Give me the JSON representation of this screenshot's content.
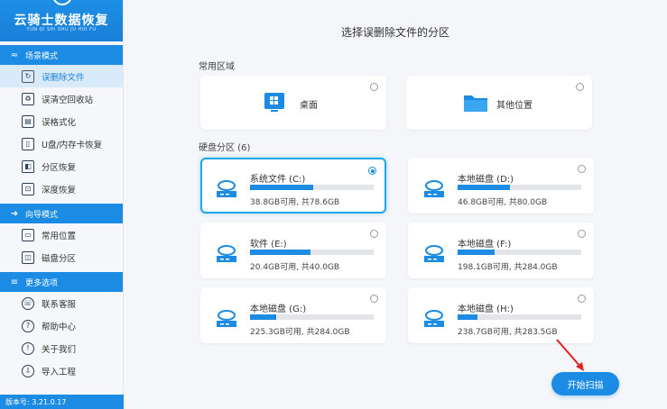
{
  "app": {
    "brand": "云骑士数据恢复",
    "brand_sub": "YUN QI SHI SHU JU HUI FU",
    "version": "版本号: 3.21.0.17"
  },
  "sidebar": {
    "sections": [
      {
        "title": "场景模式",
        "icon": "scene-icon",
        "items": [
          {
            "label": "误删除文件",
            "icon": "file-restore-icon",
            "active": true
          },
          {
            "label": "误清空回收站",
            "icon": "recycle-bin-icon",
            "active": false
          },
          {
            "label": "误格式化",
            "icon": "format-icon",
            "active": false
          },
          {
            "label": "U盘/内存卡恢复",
            "icon": "usb-icon",
            "active": false
          },
          {
            "label": "分区恢复",
            "icon": "partition-icon",
            "active": false
          },
          {
            "label": "深度恢复",
            "icon": "deep-scan-icon",
            "active": false
          }
        ]
      },
      {
        "title": "向导模式",
        "icon": "guide-icon",
        "items": [
          {
            "label": "常用位置",
            "icon": "monitor-icon",
            "active": false
          },
          {
            "label": "磁盘分区",
            "icon": "disk-icon",
            "active": false
          }
        ]
      },
      {
        "title": "更多选项",
        "icon": "menu-icon",
        "items": [
          {
            "label": "联系客服",
            "icon": "support-icon",
            "active": false
          },
          {
            "label": "帮助中心",
            "icon": "help-icon",
            "active": false
          },
          {
            "label": "关于我们",
            "icon": "info-icon",
            "active": false
          },
          {
            "label": "导入工程",
            "icon": "import-icon",
            "active": false
          }
        ]
      }
    ]
  },
  "main": {
    "title": "选择误删除文件的分区",
    "common_label": "常用区域",
    "locations": [
      {
        "label": "桌面",
        "icon": "desktop-icon"
      },
      {
        "label": "其他位置",
        "icon": "folder-icon"
      }
    ],
    "disks_label": "硬盘分区 (6)",
    "disks": [
      {
        "name": "系统文件 (C:)",
        "info": "38.8GB可用, 共78.6GB",
        "used_fraction": 0.51,
        "selected": true
      },
      {
        "name": "本地磁盘 (D:)",
        "info": "46.8GB可用, 共80.0GB",
        "used_fraction": 0.42,
        "selected": false
      },
      {
        "name": "软件 (E:)",
        "info": "20.4GB可用, 共40.0GB",
        "used_fraction": 0.49,
        "selected": false
      },
      {
        "name": "本地磁盘 (F:)",
        "info": "198.1GB可用, 共284.0GB",
        "used_fraction": 0.3,
        "selected": false
      },
      {
        "name": "本地磁盘 (G:)",
        "info": "225.3GB可用, 共284.0GB",
        "used_fraction": 0.21,
        "selected": false
      },
      {
        "name": "本地磁盘 (H:)",
        "info": "238.7GB可用, 共283.5GB",
        "used_fraction": 0.16,
        "selected": false
      }
    ],
    "scan_button": "开始扫描"
  },
  "colors": {
    "accent": "#1b8be3",
    "selected_border": "#22a7e6",
    "background": "#f4f6f9"
  }
}
